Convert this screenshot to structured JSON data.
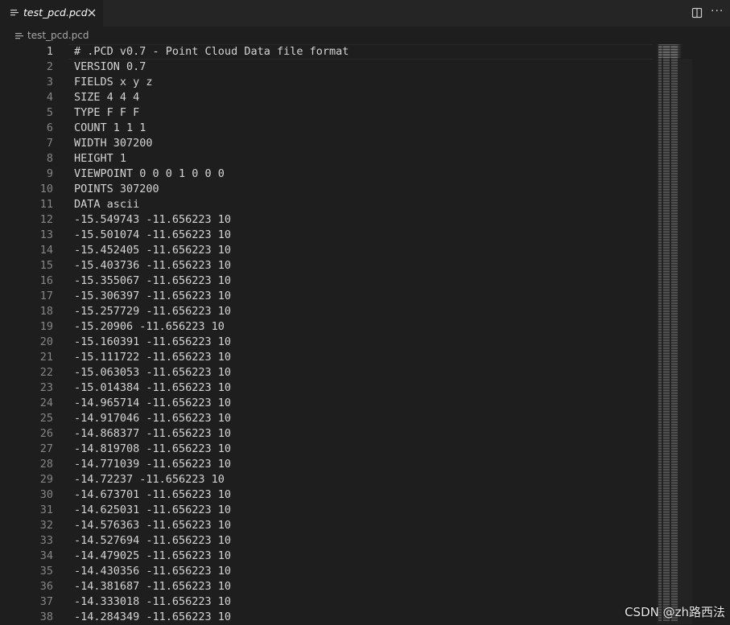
{
  "tab": {
    "label": "test_pcd.pcd",
    "file_icon": "lines-file-icon",
    "close_icon": "close-icon"
  },
  "toolbar": {
    "split_icon": "split-editor-icon",
    "more_label": "···"
  },
  "breadcrumb": {
    "file_label": "test_pcd.pcd"
  },
  "editor": {
    "active_line": 1,
    "lines": [
      {
        "num": "1",
        "text": "# .PCD v0.7 - Point Cloud Data file format"
      },
      {
        "num": "2",
        "text": "VERSION 0.7"
      },
      {
        "num": "3",
        "text": "FIELDS x y z"
      },
      {
        "num": "4",
        "text": "SIZE 4 4 4"
      },
      {
        "num": "5",
        "text": "TYPE F F F"
      },
      {
        "num": "6",
        "text": "COUNT 1 1 1"
      },
      {
        "num": "7",
        "text": "WIDTH 307200"
      },
      {
        "num": "8",
        "text": "HEIGHT 1"
      },
      {
        "num": "9",
        "text": "VIEWPOINT 0 0 0 1 0 0 0"
      },
      {
        "num": "10",
        "text": "POINTS 307200"
      },
      {
        "num": "11",
        "text": "DATA ascii"
      },
      {
        "num": "12",
        "text": "-15.549743 -11.656223 10"
      },
      {
        "num": "13",
        "text": "-15.501074 -11.656223 10"
      },
      {
        "num": "14",
        "text": "-15.452405 -11.656223 10"
      },
      {
        "num": "15",
        "text": "-15.403736 -11.656223 10"
      },
      {
        "num": "16",
        "text": "-15.355067 -11.656223 10"
      },
      {
        "num": "17",
        "text": "-15.306397 -11.656223 10"
      },
      {
        "num": "18",
        "text": "-15.257729 -11.656223 10"
      },
      {
        "num": "19",
        "text": "-15.20906 -11.656223 10"
      },
      {
        "num": "20",
        "text": "-15.160391 -11.656223 10"
      },
      {
        "num": "21",
        "text": "-15.111722 -11.656223 10"
      },
      {
        "num": "22",
        "text": "-15.063053 -11.656223 10"
      },
      {
        "num": "23",
        "text": "-15.014384 -11.656223 10"
      },
      {
        "num": "24",
        "text": "-14.965714 -11.656223 10"
      },
      {
        "num": "25",
        "text": "-14.917046 -11.656223 10"
      },
      {
        "num": "26",
        "text": "-14.868377 -11.656223 10"
      },
      {
        "num": "27",
        "text": "-14.819708 -11.656223 10"
      },
      {
        "num": "28",
        "text": "-14.771039 -11.656223 10"
      },
      {
        "num": "29",
        "text": "-14.72237 -11.656223 10"
      },
      {
        "num": "30",
        "text": "-14.673701 -11.656223 10"
      },
      {
        "num": "31",
        "text": "-14.625031 -11.656223 10"
      },
      {
        "num": "32",
        "text": "-14.576363 -11.656223 10"
      },
      {
        "num": "33",
        "text": "-14.527694 -11.656223 10"
      },
      {
        "num": "34",
        "text": "-14.479025 -11.656223 10"
      },
      {
        "num": "35",
        "text": "-14.430356 -11.656223 10"
      },
      {
        "num": "36",
        "text": "-14.381687 -11.656223 10"
      },
      {
        "num": "37",
        "text": "-14.333018 -11.656223 10"
      },
      {
        "num": "38",
        "text": "-14.284349 -11.656223 10"
      }
    ]
  },
  "minimap": {
    "icon": "minimap"
  },
  "watermark": {
    "text": "CSDN @zh路西法"
  },
  "colors": {
    "background": "#1e1e1e",
    "tabbar": "#252526",
    "text": "#d4d4d4",
    "line_number": "#858585"
  }
}
